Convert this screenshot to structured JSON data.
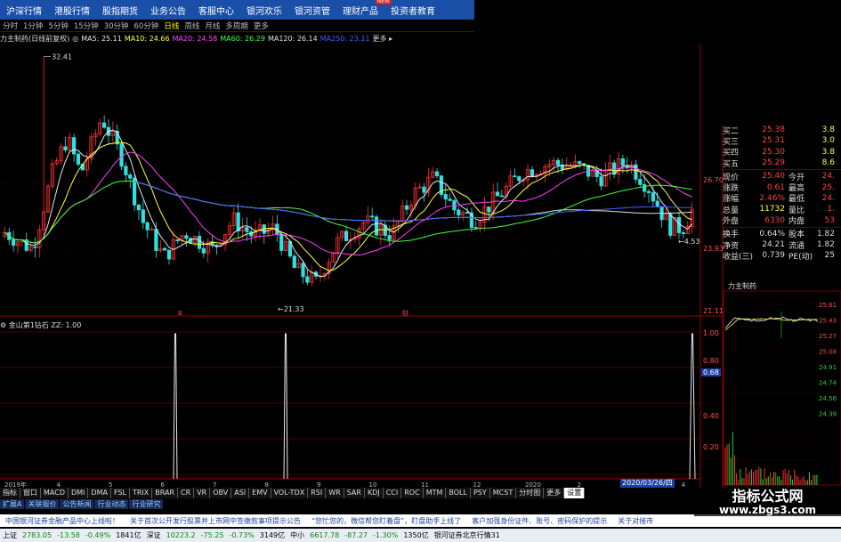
{
  "topnav": {
    "items": [
      "沪深行情",
      "港股行情",
      "股指期货",
      "业务公告",
      "客服中心",
      "银河欢乐",
      "银河资管",
      "理财产品",
      "投资者教育"
    ],
    "new_badge": "NEW"
  },
  "periods": [
    "分时",
    "1分钟",
    "5分钟",
    "15分钟",
    "30分钟",
    "60分钟",
    "日线",
    "周线",
    "月线",
    "多周期",
    "更多"
  ],
  "active_period": "日线",
  "ma_legend": {
    "prefix": "力主制药(日线前复权)",
    "items": [
      {
        "label": "MA5: 25.11",
        "color": "#e8e8e8"
      },
      {
        "label": "MA10: 24.66",
        "color": "#ffff40"
      },
      {
        "label": "MA20: 24.58",
        "color": "#ff40ff"
      },
      {
        "label": "MA60: 26.29",
        "color": "#40ff40"
      },
      {
        "label": "MA120: 26.14",
        "color": "#e0e0e0"
      },
      {
        "label": "MA250: 23.11",
        "color": "#4060ff"
      }
    ],
    "more": "更多 ▸"
  },
  "price_axis": {
    "labels": [
      "26.70",
      "23.93",
      "21.11"
    ]
  },
  "chart_labels": {
    "high": "32.41",
    "low": "21.33",
    "last": "4.53"
  },
  "indicator": {
    "legend": "金山第1钻石 ZZ: 1.00",
    "axis": [
      "1.00",
      "0.80",
      "0.68",
      "0.40",
      "0.20"
    ],
    "current": "0.68"
  },
  "quote": {
    "rows": [
      {
        "l": "买二",
        "v": "25.38",
        "v2": "3.8",
        "c": "#ff4040"
      },
      {
        "l": "买三",
        "v": "25.31",
        "v2": "3.0",
        "c": "#ff4040"
      },
      {
        "l": "买四",
        "v": "25.30",
        "v2": "3.8",
        "c": "#ff4040"
      },
      {
        "l": "买五",
        "v": "25.29",
        "v2": "8.6",
        "c": "#ff4040"
      }
    ],
    "stats": [
      {
        "l": "现价",
        "v": "25.40",
        "l2": "今开",
        "v2": "24.",
        "c": "#ff4040"
      },
      {
        "l": "涨跌",
        "v": "0.61",
        "l2": "最高",
        "v2": "25.",
        "c": "#ff4040"
      },
      {
        "l": "涨幅",
        "v": "2.46%",
        "l2": "最低",
        "v2": "24.",
        "c": "#ff4040"
      },
      {
        "l": "总量",
        "v": "11732",
        "l2": "量比",
        "v2": "1.",
        "c": "#ffff40"
      },
      {
        "l": "外盘",
        "v": "6330",
        "l2": "内盘",
        "v2": "53",
        "c": "#ff4040"
      }
    ],
    "stats2": [
      {
        "l": "换手",
        "v": "0.64%",
        "l2": "股本",
        "v2": "1.82"
      },
      {
        "l": "净资",
        "v": "24.21",
        "l2": "流通",
        "v2": "1.82"
      },
      {
        "l": "收益(三)",
        "v": "0.739",
        "l2": "PE(动)",
        "v2": "25"
      }
    ]
  },
  "mini_chart": {
    "title": "力主制药",
    "axis": [
      "25.61",
      "25.43",
      "25.27",
      "25.08",
      "24.91",
      "24.74",
      "24.56",
      "24.39"
    ]
  },
  "date_tag": "2020/03/26/四",
  "tabs": [
    "指标",
    "窗口",
    "MACD",
    "DMI",
    "DMA",
    "FSL",
    "TRIX",
    "BRAR",
    "CR",
    "VR",
    "OBV",
    "ASI",
    "EMV",
    "VOL-TDX",
    "RSI",
    "WR",
    "SAR",
    "KDJ",
    "CCI",
    "ROC",
    "MTM",
    "BOLL",
    "PSY",
    "MCST",
    "分时图",
    "更多",
    "设置"
  ],
  "active_tab": "设置",
  "tabs2": [
    "扩展A",
    "关联报价",
    "公告新闻",
    "行业动态",
    "行业研究"
  ],
  "ticker": [
    "中国银河证券金融产品中心上线啦！",
    "关于首次公开发行股票并上市网中签缴款事项提示公告",
    "“您忙您的，微信帮您盯着盘”，盯盘助手上线了",
    "客户加强身份证件、账号、密码保护的提示",
    "关于对接市"
  ],
  "status": [
    {
      "t": "上证",
      "c": "#000"
    },
    {
      "t": "2783.05",
      "c": "#0a8a0a"
    },
    {
      "t": "-13.58",
      "c": "#0a8a0a"
    },
    {
      "t": "-0.49%",
      "c": "#0a8a0a"
    },
    {
      "t": "1841亿",
      "c": "#000"
    },
    {
      "t": "深证",
      "c": "#000"
    },
    {
      "t": "10223.2",
      "c": "#0a8a0a"
    },
    {
      "t": "-75.25",
      "c": "#0a8a0a"
    },
    {
      "t": "-0.73%",
      "c": "#0a8a0a"
    },
    {
      "t": "3149亿",
      "c": "#000"
    },
    {
      "t": "中小",
      "c": "#000"
    },
    {
      "t": "6617.78",
      "c": "#0a8a0a"
    },
    {
      "t": "-87.27",
      "c": "#0a8a0a"
    },
    {
      "t": "-1.30%",
      "c": "#0a8a0a"
    },
    {
      "t": "1350亿",
      "c": "#000"
    },
    {
      "t": "银河证券北京行情31",
      "c": "#000"
    }
  ],
  "watermark": {
    "line1": "指标公式网",
    "line2": "www.zbgs3.com"
  },
  "colors": {
    "up": "#ff3030",
    "down": "#30e0e0",
    "grid": "#4a0000",
    "nav": "#1a4fa8"
  }
}
